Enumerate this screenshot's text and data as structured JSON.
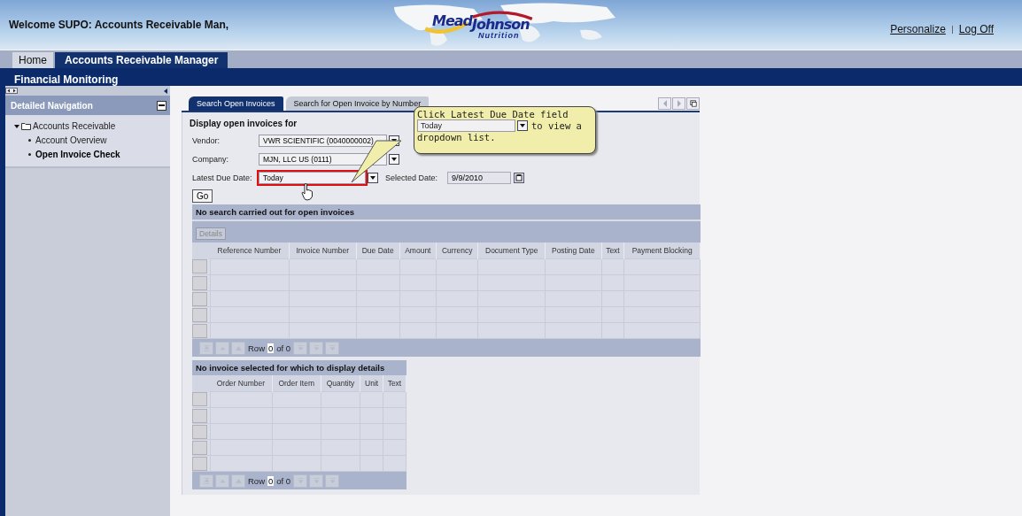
{
  "header": {
    "welcome": "Welcome SUPO: Accounts Receivable Man,",
    "logo": {
      "brand_1": "Mead",
      "brand_2": "Johnson",
      "tagline": "Nutrition"
    },
    "links": [
      "Personalize",
      "Log Off"
    ]
  },
  "top_tabs": [
    {
      "label": "Home",
      "selected": false
    },
    {
      "label": "Accounts Receivable Manager",
      "selected": true
    }
  ],
  "sub_nav": {
    "label": "Financial Monitoring"
  },
  "sidebar": {
    "title": "Detailed Navigation",
    "items": [
      {
        "label": "Accounts Receivable",
        "expanded": true,
        "children": [
          {
            "label": "Account Overview",
            "selected": false
          },
          {
            "label": "Open Invoice Check",
            "selected": true
          }
        ]
      }
    ]
  },
  "content_tabs": [
    {
      "label": "Search Open Invoices",
      "selected": true
    },
    {
      "label": "Search for Open Invoice by Number",
      "selected": false
    }
  ],
  "form": {
    "heading": "Display open invoices for",
    "fields": [
      {
        "label": "Vendor:",
        "value": "VWR SCIENTIFIC (0040000002)",
        "highlighted": false
      },
      {
        "label": "Company:",
        "value": "MJN, LLC US (0111)",
        "highlighted": false
      },
      {
        "label": "Latest Due Date:",
        "value": "Today",
        "highlighted": true
      }
    ],
    "selected_date": {
      "label": "Selected Date:",
      "value": "9/9/2010"
    },
    "go_button": "Go"
  },
  "callout": {
    "line_1": "Click Latest Due Date field",
    "dropdown_value": "Today",
    "line_2": "to view a",
    "line_3": "dropdown list."
  },
  "results": {
    "title": "No search carried out for open invoices",
    "details_button": {
      "label": "Details",
      "disabled": true
    },
    "columns": [
      "Reference Number",
      "Invoice Number",
      "Due Date",
      "Amount",
      "Currency",
      "Document Type",
      "Posting Date",
      "Text",
      "Payment Blocking"
    ],
    "pager": {
      "label": "Row",
      "value": "0",
      "total": "of 0"
    }
  },
  "details": {
    "title": "No invoice selected for which to display details",
    "columns": [
      "Order Number",
      "Order Item",
      "Quantity",
      "Unit",
      "Text"
    ],
    "pager": {
      "label": "Row",
      "value": "0",
      "total": "of 0"
    }
  }
}
